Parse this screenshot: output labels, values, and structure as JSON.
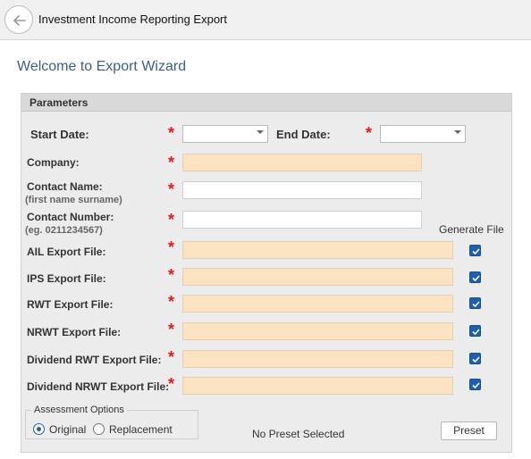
{
  "window": {
    "title": "Investment Income Reporting Export",
    "back_icon": "arrow-left-icon"
  },
  "welcome": "Welcome to Export Wizard",
  "panel": {
    "title": "Parameters",
    "required_mark": "*",
    "start_date": {
      "label": "Start Date:",
      "value": ""
    },
    "end_date": {
      "label": "End Date:",
      "value": ""
    },
    "company": {
      "label": "Company:",
      "value": ""
    },
    "contact_name": {
      "label": "Contact Name:",
      "hint": "(first name surname)",
      "value": ""
    },
    "contact_number": {
      "label": "Contact Number:",
      "hint": "(eg. 0211234567)",
      "value": ""
    },
    "generate_file_header": "Generate File",
    "exports": [
      {
        "label": "AIL Export File:",
        "value": "",
        "generate": true
      },
      {
        "label": "IPS Export File:",
        "value": "",
        "generate": true
      },
      {
        "label": "RWT Export File:",
        "value": "",
        "generate": true
      },
      {
        "label": "NRWT Export File:",
        "value": "",
        "generate": true
      },
      {
        "label": "Dividend RWT Export File:",
        "value": "",
        "generate": true
      },
      {
        "label": "Dividend NRWT Export File:",
        "value": "",
        "generate": true
      }
    ],
    "assessment": {
      "title": "Assessment Options",
      "options": [
        {
          "label": "Original",
          "selected": true
        },
        {
          "label": "Replacement",
          "selected": false
        }
      ]
    },
    "preset_status": "No Preset Selected",
    "preset_button": "Preset"
  },
  "colors": {
    "accent": "#1f5fb0",
    "required": "#e11b1b",
    "required_field_bg": "#fbe3c2",
    "heading": "#3d5f8c"
  }
}
